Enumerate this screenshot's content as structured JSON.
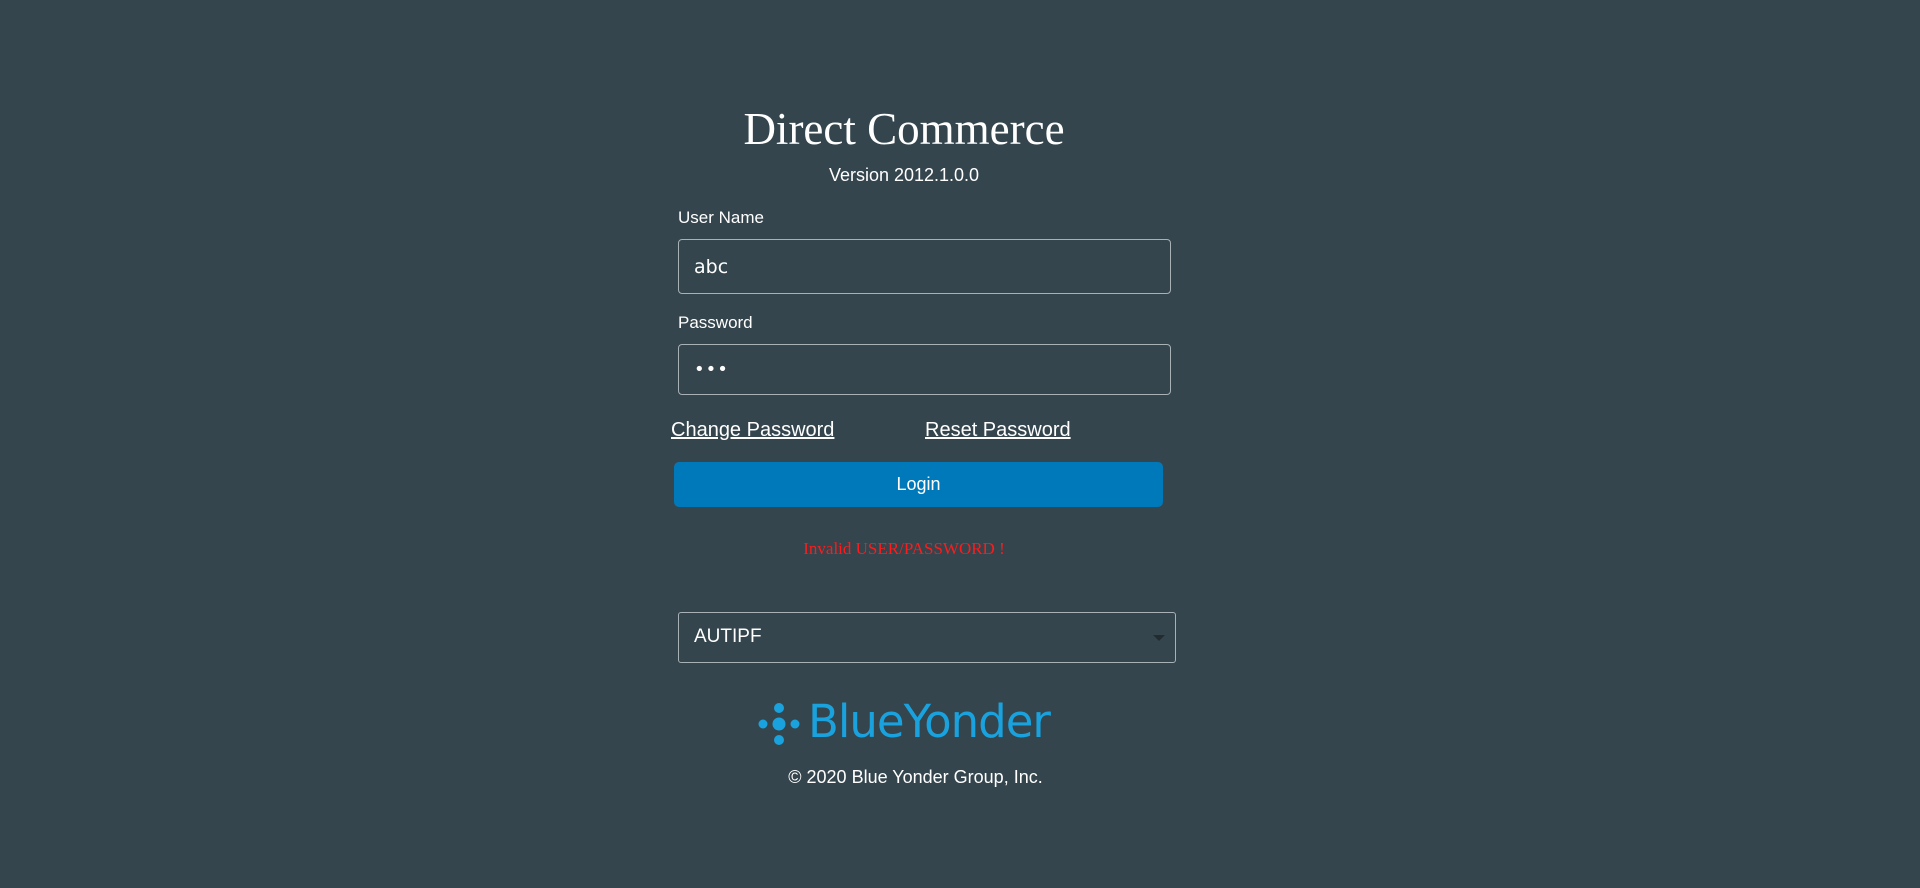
{
  "app": {
    "title": "Direct Commerce",
    "version": "Version 2012.1.0.0"
  },
  "form": {
    "username_label": "User Name",
    "username_value": "abc",
    "password_label": "Password",
    "password_value": "•••"
  },
  "links": {
    "change_password": "Change Password",
    "reset_password": "Reset Password"
  },
  "login_button": "Login",
  "error": "Invalid USER/PASSWORD !",
  "environment": {
    "selected": "AUTIPF"
  },
  "branding": {
    "logo_text": "BlueYonder",
    "logo_icon": "blue-yonder-logo-icon",
    "copyright": "© 2020 Blue Yonder Group, Inc."
  },
  "colors": {
    "background": "#34454d",
    "button": "#0079bb",
    "error": "#ff1b1b",
    "brand": "#19a2dd"
  }
}
